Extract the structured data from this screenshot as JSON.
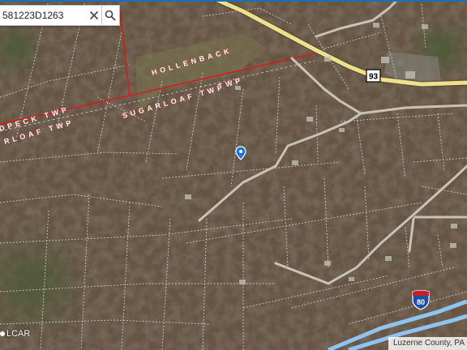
{
  "search": {
    "value": "581223D1263",
    "clear_icon": "close-icon",
    "search_icon": "search-icon"
  },
  "map": {
    "township_labels": [
      "HOLLENBACK",
      "TWP",
      "SUGARLOAF TWP",
      "DPECK TWP",
      "RLOAF TWP"
    ],
    "route_shields": [
      {
        "type": "state",
        "number": "93"
      },
      {
        "type": "interstate",
        "number": "80"
      }
    ],
    "marker_icon": "map-pin-icon",
    "colors": {
      "township_boundary": "#d21d1d",
      "parcel_lines": "#d8d8d8",
      "highway": "#f1e08a",
      "interstate": "#8fc4f2",
      "road": "#c9c2b6",
      "marker": "#1a73e8"
    }
  },
  "attribution": "Luzerne County, PA",
  "logo": "LCAR"
}
